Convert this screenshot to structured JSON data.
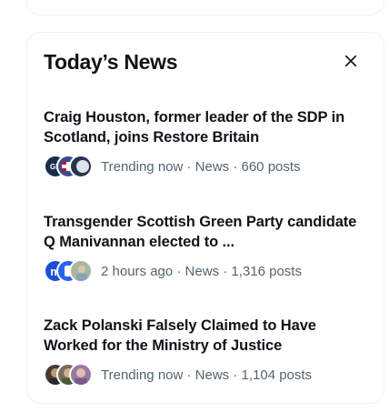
{
  "trends_panel": {
    "title": "Today’s News",
    "close_icon": "close-icon",
    "stories": [
      {
        "headline": "Craig Houston, former leader of the SDP in Scotland, joins Restore Britain",
        "meta": "Trending now · News · 660 posts",
        "avatars": [
          {
            "label": "GB",
            "color": "#1a2a4a"
          },
          {
            "label": "",
            "color": "#3b4b8a"
          },
          {
            "label": "",
            "color": "#2a3550"
          }
        ]
      },
      {
        "headline": "Transgender Scottish Green Party candidate Q Manivannan elected to ...",
        "meta": "2 hours ago · News · 1,316 posts",
        "avatars": [
          {
            "label": "m",
            "color": "#1d4ed8"
          },
          {
            "label": "",
            "color": "#2563eb"
          },
          {
            "label": "",
            "color": "#a8b8a0"
          }
        ]
      },
      {
        "headline": "Zack Polanski Falsely Claimed to Have Worked for the Ministry of Justice",
        "meta": "Trending now · News · 1,104 posts",
        "avatars": [
          {
            "label": "",
            "color": "#4a3a32"
          },
          {
            "label": "",
            "color": "#7a6a5a"
          },
          {
            "label": "",
            "color": "#9a7aa0"
          }
        ]
      }
    ]
  }
}
